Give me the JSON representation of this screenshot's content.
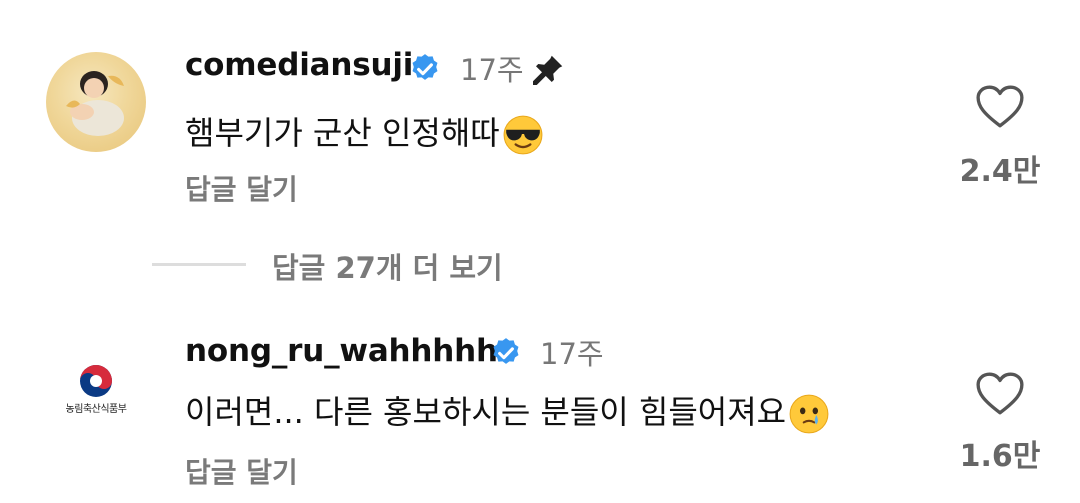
{
  "comments": [
    {
      "username": "comediansuji",
      "verified": true,
      "time": "17주",
      "pinned": true,
      "text": "햄부기가 군산 인정해따",
      "emoji": "smiling-face-with-sunglasses-emoji",
      "reply_label": "답글 달기",
      "like_count": "2.4만"
    },
    {
      "username": "nong_ru_wahhhhh",
      "verified": true,
      "time": "17주",
      "pinned": false,
      "text": "이러면... 다른 홍보하시는 분들이 힘들어져요",
      "emoji": "face-holding-back-tears-emoji",
      "reply_label": "답글 달기",
      "like_count": "1.6만",
      "avatar_logo_text": "농림축산식품부"
    }
  ],
  "view_more_replies": "답글 27개 더 보기",
  "colors": {
    "verified_blue": "#3897f0",
    "muted_text": "#7a7a7a"
  }
}
